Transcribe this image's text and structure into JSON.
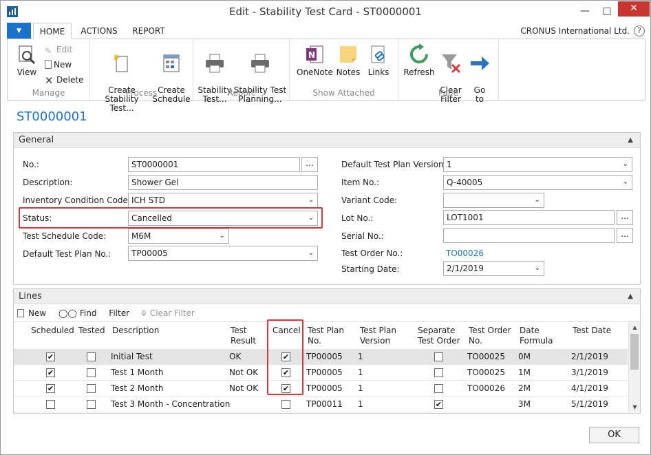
{
  "window": {
    "title": "Edit - Stability Test Card - ST0000001"
  },
  "ribbon_tabs": [
    "HOME",
    "ACTIONS",
    "REPORT"
  ],
  "company": "CRONUS International Ltd.",
  "ribbon": {
    "manage": {
      "label": "Manage",
      "view": "View",
      "edit": "Edit",
      "new": "New",
      "delete": "Delete"
    },
    "process": {
      "label": "Process",
      "create_stability_test": "Create\nStability Test...",
      "create_schedule": "Create\nSchedule"
    },
    "report": {
      "label": "Report",
      "stability_test": "Stability\nTest...",
      "stability_test_planning": "Stability Test\nPlanning..."
    },
    "show_attached": {
      "label": "Show Attached",
      "onenote": "OneNote",
      "notes": "Notes",
      "links": "Links"
    },
    "page": {
      "label": "Page",
      "refresh": "Refresh",
      "clear_filter": "Clear\nFilter",
      "go_to": "Go\nto"
    }
  },
  "page_title": "ST0000001",
  "general": {
    "header": "General",
    "no_label": "No.:",
    "no_value": "ST0000001",
    "description_label": "Description:",
    "description_value": "Shower Gel",
    "inventory_condition_label": "Inventory Condition Code:",
    "inventory_condition_value": "ICH STD",
    "status_label": "Status:",
    "status_value": "Cancelled",
    "test_schedule_label": "Test Schedule Code:",
    "test_schedule_value": "M6M",
    "default_test_plan_label": "Default Test Plan No.:",
    "default_test_plan_value": "TP00005",
    "default_test_plan_version_label": "Default Test Plan Version:",
    "default_test_plan_version_value": "1",
    "item_no_label": "Item No.:",
    "item_no_value": "Q-40005",
    "variant_code_label": "Variant Code:",
    "variant_code_value": "",
    "lot_no_label": "Lot No.:",
    "lot_no_value": "LOT1001",
    "serial_no_label": "Serial No.:",
    "serial_no_value": "",
    "test_order_label": "Test Order No.:",
    "test_order_value": "TO00026",
    "starting_date_label": "Starting Date:",
    "starting_date_value": "2/1/2019",
    "ellipsis": "..."
  },
  "lines": {
    "header": "Lines",
    "toolbar": {
      "new": "New",
      "find": "Find",
      "filter": "Filter",
      "clear_filter": "Clear Filter"
    },
    "columns": {
      "scheduled": "Scheduled",
      "tested": "Tested",
      "description": "Description",
      "test_result": "Test\nResult",
      "cancel": "Cancel",
      "test_plan_no": "Test Plan\nNo.",
      "test_plan_version": "Test Plan\nVersion",
      "separate_test_order": "Separate\nTest Order",
      "test_order_no": "Test Order\nNo.",
      "date_formula": "Date\nFormula",
      "test_date": "Test Date"
    },
    "rows": [
      {
        "scheduled": true,
        "tested": false,
        "description": "Initial Test",
        "test_result": "OK",
        "cancel": true,
        "test_plan_no": "TP00005",
        "test_plan_version": "1",
        "separate_test_order": false,
        "test_order_no": "TO00025",
        "date_formula": "0M",
        "test_date": "2/1/2019"
      },
      {
        "scheduled": true,
        "tested": false,
        "description": "Test 1 Month",
        "test_result": "Not OK",
        "cancel": true,
        "test_plan_no": "TP00005",
        "test_plan_version": "1",
        "separate_test_order": false,
        "test_order_no": "TO00025",
        "date_formula": "1M",
        "test_date": "3/1/2019"
      },
      {
        "scheduled": true,
        "tested": false,
        "description": "Test 2 Month",
        "test_result": "Not OK",
        "cancel": true,
        "test_plan_no": "TP00005",
        "test_plan_version": "1",
        "separate_test_order": false,
        "test_order_no": "TO00026",
        "date_formula": "2M",
        "test_date": "4/1/2019"
      },
      {
        "scheduled": false,
        "tested": false,
        "description": "Test 3 Month - Concentration",
        "test_result": "",
        "cancel": false,
        "test_plan_no": "TP00011",
        "test_plan_version": "1",
        "separate_test_order": true,
        "test_order_no": "",
        "date_formula": "3M",
        "test_date": "5/1/2019"
      }
    ]
  },
  "ok_button": "OK",
  "colors": {
    "accent": "#1f74bf",
    "highlight": "#d9363e",
    "file_button": "#1a73c9",
    "close_button": "#c7372f"
  }
}
